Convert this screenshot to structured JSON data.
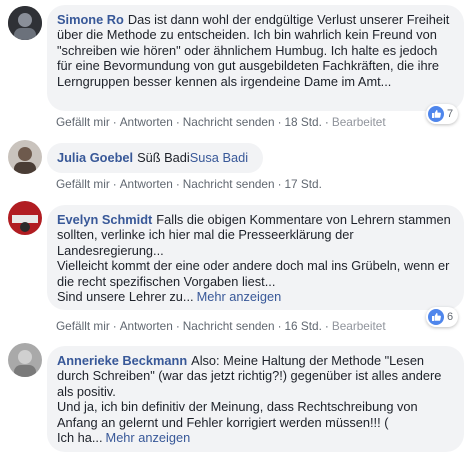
{
  "comments": [
    {
      "author": "Simone Ro",
      "text": "Das ist dann wohl der endgültige Verlust unserer Freiheit über die Methode zu entscheiden. Ich bin wahrlich kein Freund von \"schreiben wie hören\" oder ähnlichem Humbug. Ich halte es jedoch für eine Bevormundung von gut ausgebildeten Fachkräften, die ihre Lerngruppen besser kennen als irgendeine Dame im Amt...",
      "actions": {
        "like": "Gefällt mir",
        "reply": "Antworten",
        "message": "Nachricht senden",
        "time": "18 Std.",
        "edited": "Bearbeitet"
      },
      "reaction_count": "7"
    },
    {
      "author": "Julia Goebel",
      "text": "Süß Badi",
      "tag": "Susa Badi",
      "actions": {
        "like": "Gefällt mir",
        "reply": "Antworten",
        "message": "Nachricht senden",
        "time": "17 Std."
      }
    },
    {
      "author": "Evelyn Schmidt",
      "text": "Falls die obigen Kommentare von Lehrern stammen sollten, verlinke ich hier mal die Presseerklärung der Landesregierung...\nVielleicht kommt der eine oder andere doch mal ins Grübeln, wenn er die recht spezifischen Vorgaben liest...\nSind unsere Lehrer zu...",
      "more": "Mehr anzeigen",
      "actions": {
        "like": "Gefällt mir",
        "reply": "Antworten",
        "message": "Nachricht senden",
        "time": "16 Std.",
        "edited": "Bearbeitet"
      },
      "reaction_count": "6"
    },
    {
      "author": "Annerieke Beckmann",
      "text": "Also: Meine Haltung der Methode \"Lesen durch Schreiben\" (war das jetzt richtig?!) gegenüber ist alles andere als positiv.\nUnd ja, ich bin definitiv der Meinung, dass Rechtschreibung von Anfang an gelernt und Fehler korrigiert werden müssen!!! (\nIch ha...",
      "more": "Mehr anzeigen"
    }
  ],
  "colors": {
    "link": "#385898",
    "bubble": "#f2f3f5",
    "muted": "#606770",
    "like_blue": "#4f86ec"
  }
}
